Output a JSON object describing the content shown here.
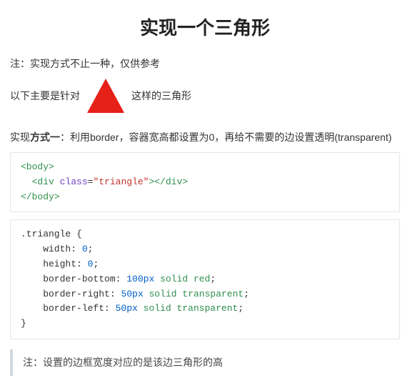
{
  "title": "实现一个三角形",
  "note": "注：实现方式不止一种，仅供参考",
  "intro_before": "以下主要是针对",
  "intro_after": "这样的三角形",
  "method1_prefix": "实现",
  "method1_bold": "方式一",
  "method1_rest": "：利用border，容器宽高都设置为0，再给不需要的边设置透明(transparent)",
  "code_html": {
    "l1_a": "<body>",
    "l2_a": "  <div",
    "l2_b": " class",
    "l2_c": "=",
    "l2_d": "\"triangle\"",
    "l2_e": "></div>",
    "l3_a": "</body>"
  },
  "code_css": {
    "l1": ".triangle {",
    "l2_a": "    width: ",
    "l2_b": "0",
    "l2_c": ";",
    "l3_a": "    height: ",
    "l3_b": "0",
    "l3_c": ";",
    "l4_a": "    border-bottom: ",
    "l4_b": "100px",
    "l4_c": " solid",
    "l4_d": " red",
    "l4_e": ";",
    "l5_a": "    border-right: ",
    "l5_b": "50px",
    "l5_c": " solid",
    "l5_d": " transparent",
    "l5_e": ";",
    "l6_a": "    border-left: ",
    "l6_b": "50px",
    "l6_c": " solid",
    "l6_d": " transparent",
    "l6_e": ";",
    "l7": "}"
  },
  "footnote": "注：设置的边框宽度对应的是该边三角形的高"
}
